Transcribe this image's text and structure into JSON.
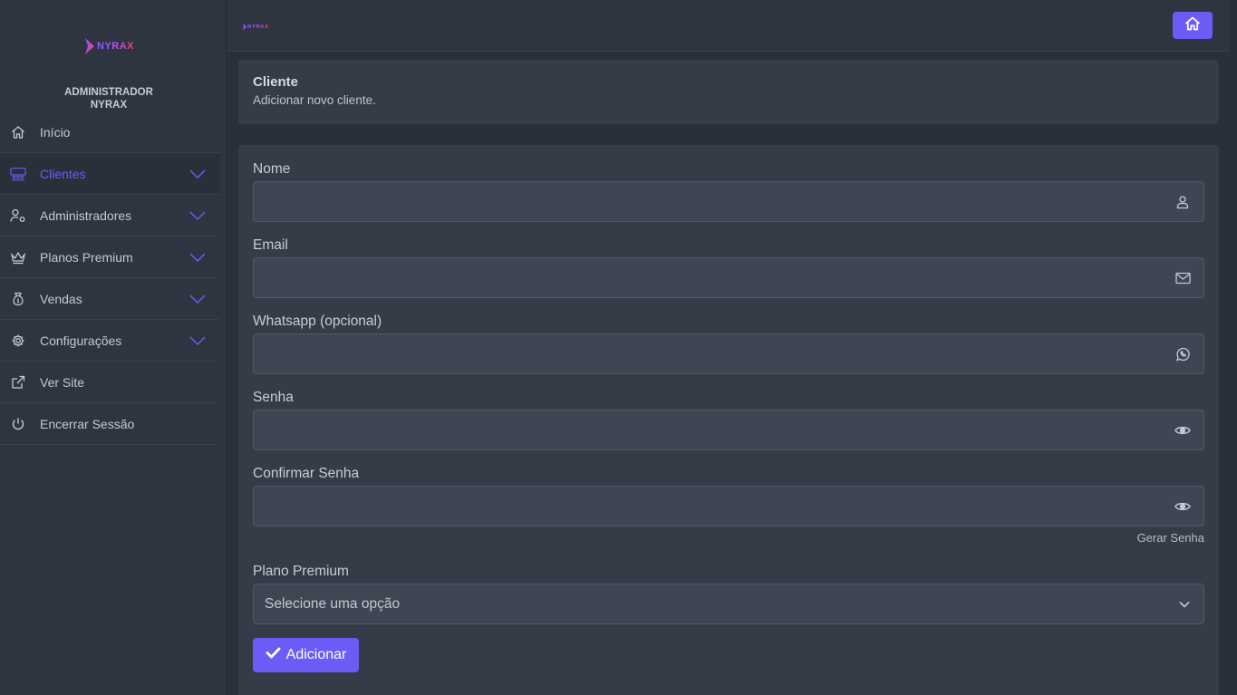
{
  "brand": {
    "name": "NYRAX",
    "accent": "#6c5cf5"
  },
  "sidebar": {
    "admin_name_line1": "ADMINISTRADOR",
    "admin_name_line2": "NYRAX",
    "items": [
      {
        "label": "Início",
        "icon": "home-icon"
      },
      {
        "label": "Clientes",
        "icon": "users-icon",
        "active": true
      },
      {
        "label": "Administradores",
        "icon": "user-cog-icon"
      },
      {
        "label": "Planos Premium",
        "icon": "crown-icon"
      },
      {
        "label": "Vendas",
        "icon": "money-bag-icon"
      },
      {
        "label": "Configurações",
        "icon": "gear-icon"
      },
      {
        "label": "Ver Site",
        "icon": "external-link-icon"
      },
      {
        "label": "Encerrar Sessão",
        "icon": "power-icon"
      }
    ]
  },
  "header": {
    "title": "Cliente",
    "subtitle": "Adicionar novo cliente."
  },
  "form": {
    "fields": [
      {
        "label": "Nome",
        "value": "",
        "icon": "user-icon"
      },
      {
        "label": "Email",
        "value": "",
        "icon": "envelope-icon"
      },
      {
        "label": "Whatsapp (opcional)",
        "value": "",
        "icon": "whatsapp-icon"
      },
      {
        "label": "Senha",
        "value": "",
        "icon": "eye-icon"
      },
      {
        "label": "Confirmar Senha",
        "value": "",
        "icon": "eye-icon"
      }
    ],
    "generate_password": "Gerar Senha",
    "plan_label": "Plano Premium",
    "plan_selected": "Selecione uma opção",
    "submit_label": "Adicionar"
  }
}
